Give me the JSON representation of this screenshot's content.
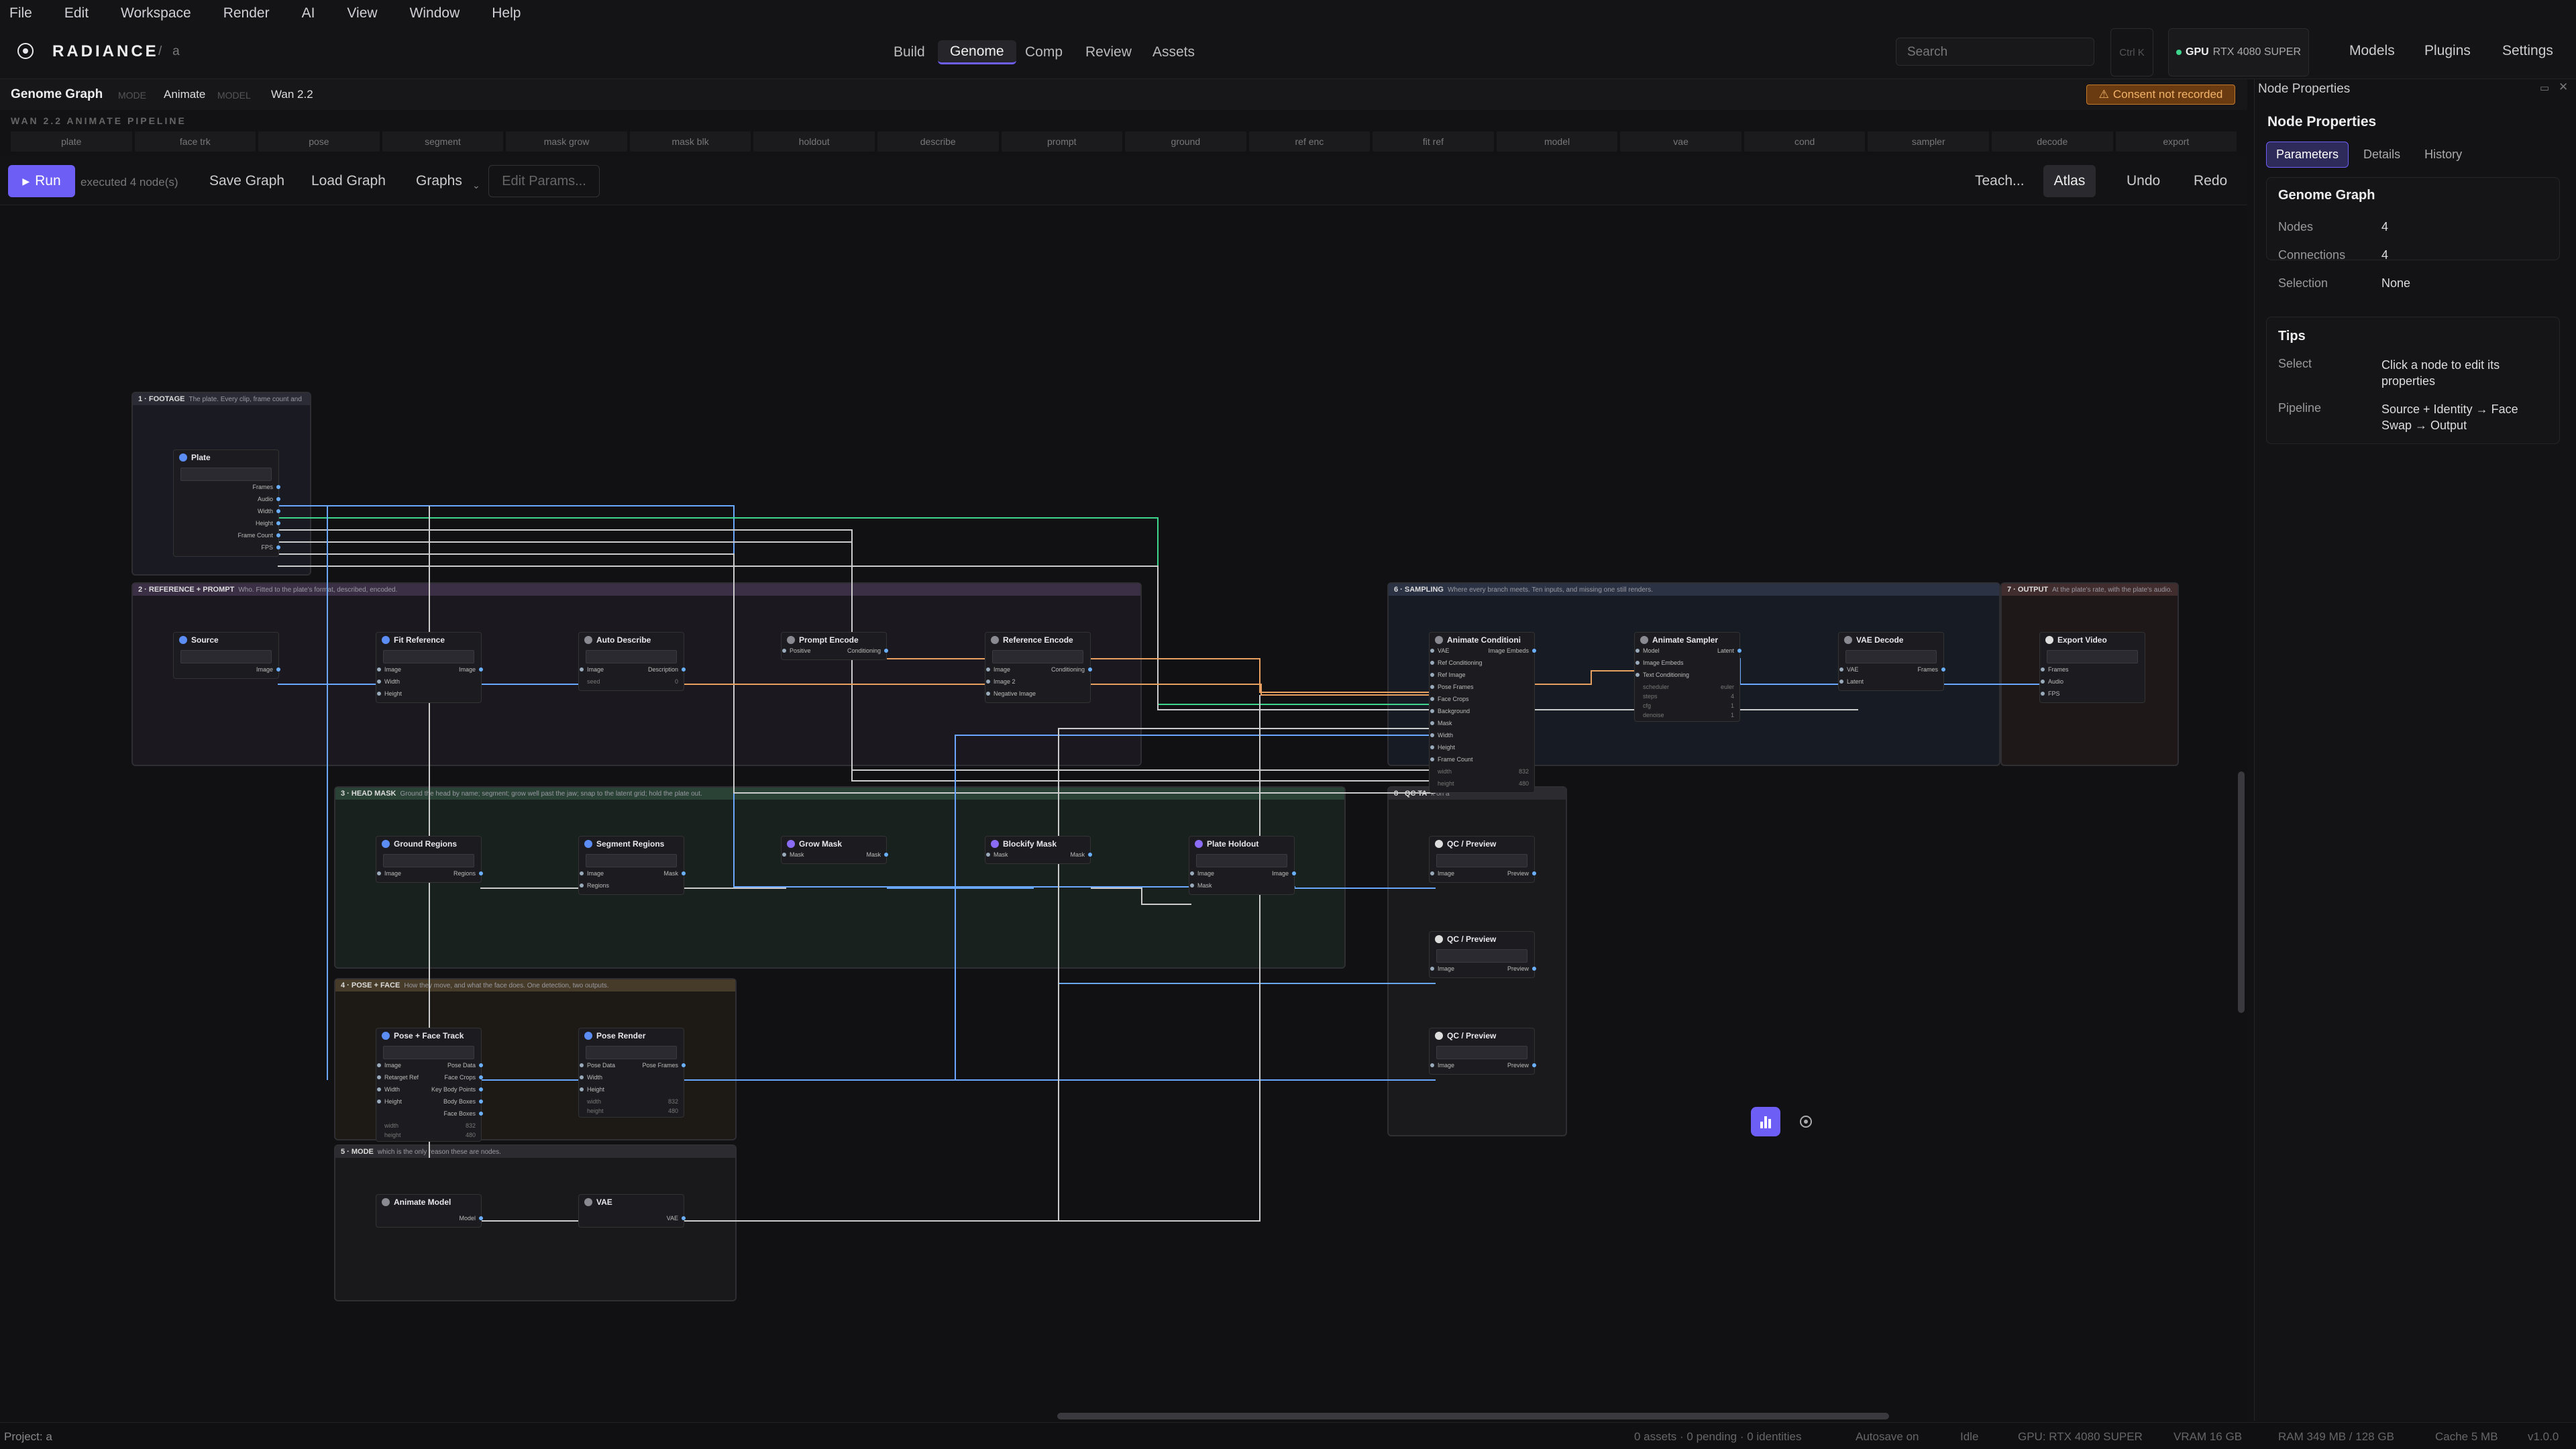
{
  "menu": [
    "File",
    "Edit",
    "Workspace",
    "Render",
    "AI",
    "View",
    "Window",
    "Help"
  ],
  "app": {
    "brand": "RADIANCE",
    "project_sep": "/",
    "project": "a"
  },
  "nav_tabs": [
    "Build",
    "Genome",
    "Comp",
    "Review",
    "Assets"
  ],
  "search": {
    "placeholder": "Search",
    "shortcut": "Ctrl K"
  },
  "gpu": {
    "label": "GPU",
    "name": "RTX 4080 SUPER"
  },
  "top_right": [
    "Models",
    "Plugins",
    "Settings"
  ],
  "graph_header": {
    "title": "Genome Graph",
    "mode_label": "MODE",
    "mode": "Animate",
    "model_label": "MODEL",
    "model": "Wan 2.2",
    "consent": "Consent not recorded"
  },
  "pipeline_label": "WAN 2.2 ANIMATE PIPELINE",
  "stages": [
    "plate",
    "face trk",
    "pose",
    "segment",
    "mask grow",
    "mask blk",
    "holdout",
    "describe",
    "prompt",
    "ground",
    "ref enc",
    "fit ref",
    "model",
    "vae",
    "cond",
    "sampler",
    "decode",
    "export"
  ],
  "toolbar": {
    "run": "Run",
    "status": "executed 4 node(s)",
    "save": "Save Graph",
    "load": "Load Graph",
    "graphs": "Graphs",
    "edit_params": "Edit Params...",
    "teach": "Teach...",
    "atlas": "Atlas",
    "undo": "Undo",
    "redo": "Redo"
  },
  "groups": [
    {
      "id": "g1",
      "title": "1 · FOOTAGE",
      "desc": "The plate. Every clip, frame count and"
    },
    {
      "id": "g2",
      "title": "2 · REFERENCE + PROMPT",
      "desc": "Who. Fitted to the plate's format, described, encoded."
    },
    {
      "id": "g3",
      "title": "3 · HEAD MASK",
      "desc": "Ground the head by name; segment; grow well past the jaw; snap to the latent grid; hold the plate out."
    },
    {
      "id": "g4",
      "title": "4 · POSE + FACE",
      "desc": "How they move, and what the face does. One detection, two outputs."
    },
    {
      "id": "g5",
      "title": "5 · MODE",
      "desc": "which is the only reason these are nodes."
    },
    {
      "id": "g6",
      "title": "6 · SAMPLING",
      "desc": "Where every branch meets. Ten inputs, and missing one still renders."
    },
    {
      "id": "g7",
      "title": "7 · OUTPUT",
      "desc": "At the plate's rate, with the plate's audio."
    },
    {
      "id": "g8",
      "title": "8 · QC TA",
      "desc": "k on a"
    }
  ],
  "nodes": {
    "plate": {
      "title": "Plate",
      "outputs": [
        "Frames",
        "Audio",
        "Width",
        "Height",
        "Frame Count",
        "FPS"
      ]
    },
    "source": {
      "title": "Source",
      "outputs": [
        "Image"
      ]
    },
    "fit_reference": {
      "title": "Fit Reference",
      "inputs": [
        "Image",
        "Width",
        "Height"
      ],
      "outputs": [
        "Image"
      ]
    },
    "auto_describe": {
      "title": "Auto Describe",
      "inputs": [
        "Image"
      ],
      "outputs": [
        "Description"
      ],
      "param_label": "seed",
      "param_value": "0"
    },
    "prompt_encode": {
      "title": "Prompt Encode",
      "inputs": [
        "Positive"
      ],
      "outputs": [
        "Conditioning"
      ]
    },
    "reference_encode": {
      "title": "Reference Encode",
      "inputs": [
        "Image",
        "Image 2",
        "Negative Image"
      ],
      "outputs": [
        "Conditioning"
      ]
    },
    "animate_conditioning": {
      "title": "Animate Conditioni",
      "inputs": [
        "VAE",
        "Ref Conditioning",
        "Ref Image",
        "Pose Frames",
        "Face Crops",
        "Background",
        "Mask",
        "Width",
        "Height",
        "Frame Count"
      ],
      "outputs": [
        "Image Embeds"
      ],
      "params": [
        {
          "k": "width",
          "v": "832"
        },
        {
          "k": "height",
          "v": "480"
        }
      ]
    },
    "animate_sampler": {
      "title": "Animate Sampler",
      "inputs": [
        "Model",
        "Image Embeds",
        "Text Conditioning"
      ],
      "outputs": [
        "Latent"
      ],
      "params": [
        {
          "k": "scheduler",
          "v": "euler"
        },
        {
          "k": "steps",
          "v": "4"
        },
        {
          "k": "cfg",
          "v": "1"
        },
        {
          "k": "denoise",
          "v": "1"
        }
      ]
    },
    "vae_decode": {
      "title": "VAE Decode",
      "inputs": [
        "VAE",
        "Latent"
      ],
      "outputs": [
        "Frames"
      ]
    },
    "export_video": {
      "title": "Export Video",
      "inputs": [
        "Frames",
        "Audio",
        "FPS"
      ]
    },
    "ground_regions": {
      "title": "Ground Regions",
      "inputs": [
        "Image"
      ],
      "outputs": [
        "Regions"
      ]
    },
    "segment_regions": {
      "title": "Segment Regions",
      "inputs": [
        "Image",
        "Regions"
      ],
      "outputs": [
        "Mask"
      ]
    },
    "grow_mask": {
      "title": "Grow Mask",
      "inputs": [
        "Mask"
      ],
      "outputs": [
        "Mask"
      ]
    },
    "blockify_mask": {
      "title": "Blockify Mask",
      "inputs": [
        "Mask"
      ],
      "outputs": [
        "Mask"
      ]
    },
    "plate_holdout": {
      "title": "Plate Holdout",
      "inputs": [
        "Image",
        "Mask"
      ],
      "outputs": [
        "Image"
      ]
    },
    "pose_face_track": {
      "title": "Pose + Face Track",
      "inputs": [
        "Image",
        "Retarget Ref",
        "Width",
        "Height"
      ],
      "outputs": [
        "Pose Data",
        "Face Crops",
        "Key Body Points",
        "Body Boxes",
        "Face Boxes"
      ],
      "params": [
        {
          "k": "width",
          "v": "832"
        },
        {
          "k": "height",
          "v": "480"
        }
      ]
    },
    "pose_render": {
      "title": "Pose Render",
      "inputs": [
        "Pose Data",
        "Width",
        "Height"
      ],
      "outputs": [
        "Pose Frames"
      ],
      "params": [
        {
          "k": "width",
          "v": "832"
        },
        {
          "k": "height",
          "v": "480"
        }
      ]
    },
    "animate_model": {
      "title": "Animate Model",
      "outputs": [
        "Model"
      ]
    },
    "vae": {
      "title": "VAE",
      "outputs": [
        "VAE"
      ]
    },
    "qc1": {
      "title": "QC / Preview",
      "inputs": [
        "Image"
      ],
      "outputs": [
        "Preview"
      ]
    },
    "qc2": {
      "title": "QC / Preview",
      "inputs": [
        "Image"
      ],
      "outputs": [
        "Preview"
      ]
    },
    "qc3": {
      "title": "QC / Preview",
      "inputs": [
        "Image"
      ],
      "outputs": [
        "Preview"
      ]
    }
  },
  "panel": {
    "header": "Node Properties",
    "title": "Node Properties",
    "tabs": [
      "Parameters",
      "Details",
      "History"
    ],
    "genome_title": "Genome Graph",
    "stats": [
      {
        "k": "Nodes",
        "v": "4"
      },
      {
        "k": "Connections",
        "v": "4"
      },
      {
        "k": "Selection",
        "v": "None"
      }
    ],
    "tips_title": "Tips",
    "tips": [
      {
        "k": "Select",
        "v": "Click a node to edit its properties"
      },
      {
        "k": "Pipeline",
        "v": "Source + Identity → Face Swap → Output"
      }
    ]
  },
  "status": {
    "project": "Project: a",
    "assets": "0 assets · 0 pending · 0 identities",
    "autosave": "Autosave on",
    "state": "Idle",
    "gpu": "GPU: RTX 4080 SUPER",
    "vram": "VRAM 16 GB",
    "ram": "RAM 349 MB / 128 GB",
    "cache": "Cache 5 MB",
    "version": "v1.0.0"
  }
}
